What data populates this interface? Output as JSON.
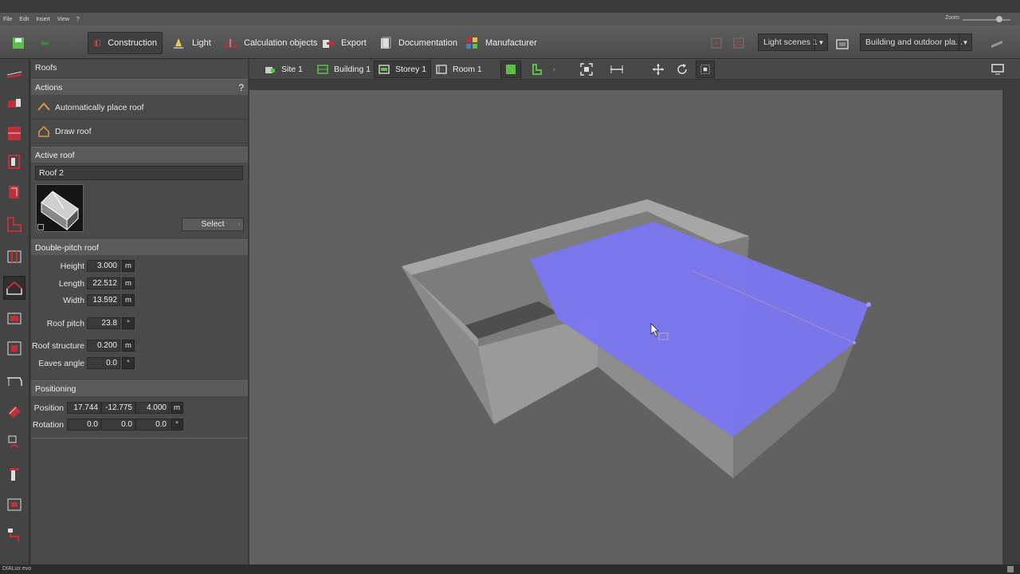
{
  "menu": [
    "File",
    "Edit",
    "Insert",
    "View",
    "?"
  ],
  "zoom_label": "Zoom",
  "toolbar": {
    "construction": "Construction",
    "light": "Light",
    "calc": "Calculation objects",
    "export": "Export",
    "documentation": "Documentation",
    "manufacturer": "Manufacturer",
    "light_scenes": "Light scenes 1",
    "view_mode": "Building and outdoor pla..."
  },
  "view_toolbar": {
    "site": "Site 1",
    "building": "Building 1",
    "storey": "Storey 1",
    "room": "Room 1"
  },
  "panel": {
    "title": "Roofs",
    "actions_header": "Actions",
    "help": "?",
    "auto_place": "Automatically place roof",
    "draw_roof": "Draw roof",
    "active_header": "Active roof",
    "active_name": "Roof 2",
    "select_btn": "Select",
    "double_header": "Double-pitch roof",
    "height_label": "Height",
    "height_val": "3.000",
    "height_unit": "m",
    "length_label": "Length",
    "length_val": "22.512",
    "length_unit": "m",
    "width_label": "Width",
    "width_val": "13.592",
    "width_unit": "m",
    "pitch_label": "Roof pitch",
    "pitch_val": "23.8",
    "pitch_unit": "°",
    "structure_label": "Roof structure",
    "structure_val": "0.200",
    "structure_unit": "m",
    "eaves_label": "Eaves angle",
    "eaves_val": "0.0",
    "eaves_unit": "°",
    "pos_header": "Positioning",
    "position_label": "Position",
    "pos_x": "17.744",
    "pos_y": "-12.775",
    "pos_z": "4.000",
    "pos_unit": "m",
    "rotation_label": "Rotation",
    "rot_x": "0.0",
    "rot_y": "0.0",
    "rot_z": "0.0",
    "rot_unit": "°"
  },
  "status": "DIALux evo",
  "colors": {
    "accent_red": "#c0303a",
    "roof_blue": "#7b76f0",
    "panel": "#4a4a4a",
    "toolbar": "#555555"
  }
}
